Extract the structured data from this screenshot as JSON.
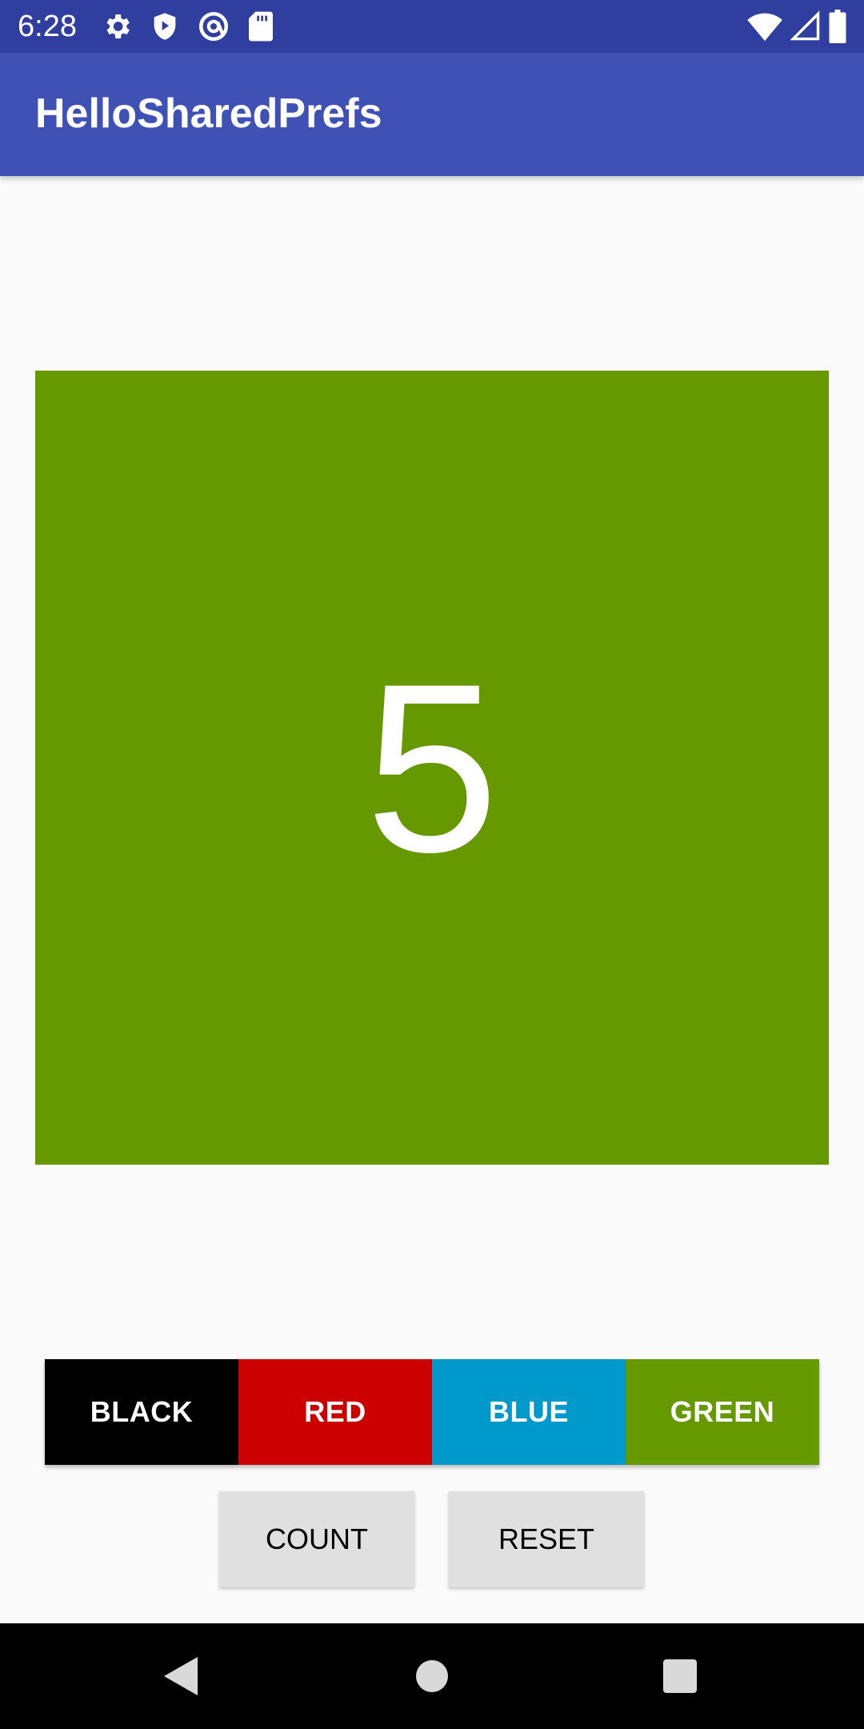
{
  "status_bar": {
    "time": "6:28",
    "left_icons": [
      "settings-gear-icon",
      "shield-play-icon",
      "at-sign-icon",
      "sd-card-icon"
    ],
    "right_icons": [
      "wifi-icon",
      "cell-signal-icon",
      "battery-icon"
    ],
    "background_color": "#303f9f"
  },
  "app_bar": {
    "title": "HelloSharedPrefs",
    "background_color": "#3f51b5"
  },
  "count_panel": {
    "value": "5",
    "background_color": "#669900"
  },
  "color_buttons": [
    {
      "label": "BLACK",
      "color": "#000000"
    },
    {
      "label": "RED",
      "color": "#cc0000"
    },
    {
      "label": "BLUE",
      "color": "#0099cc"
    },
    {
      "label": "GREEN",
      "color": "#669900"
    }
  ],
  "actions": {
    "count_label": "COUNT",
    "reset_label": "RESET"
  },
  "nav_bar": {
    "buttons": [
      "back-icon",
      "home-icon",
      "recents-icon"
    ]
  }
}
